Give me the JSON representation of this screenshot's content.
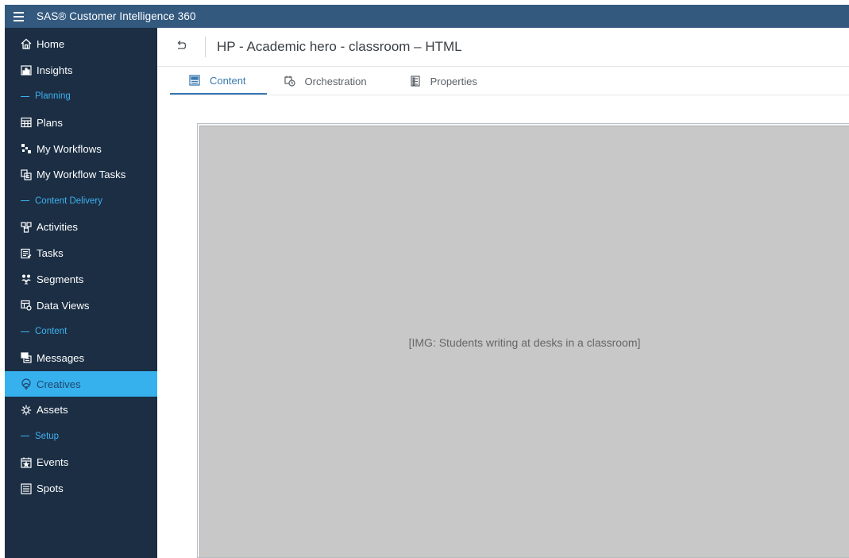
{
  "topbar": {
    "app_title": "SAS® Customer Intelligence 360",
    "menu_icon": "hamburger-icon"
  },
  "sidebar": {
    "items": [
      {
        "type": "item",
        "label": "Home",
        "icon": "home-icon"
      },
      {
        "type": "item",
        "label": "Insights",
        "icon": "insights-icon"
      },
      {
        "type": "section",
        "label": "Planning"
      },
      {
        "type": "item",
        "label": "Plans",
        "icon": "plans-icon"
      },
      {
        "type": "item",
        "label": "My Workflows",
        "icon": "workflows-icon"
      },
      {
        "type": "item",
        "label": "My Workflow Tasks",
        "icon": "workflow-tasks-icon"
      },
      {
        "type": "section",
        "label": "Content Delivery"
      },
      {
        "type": "item",
        "label": "Activities",
        "icon": "activities-icon"
      },
      {
        "type": "item",
        "label": "Tasks",
        "icon": "tasks-icon"
      },
      {
        "type": "item",
        "label": "Segments",
        "icon": "segments-icon"
      },
      {
        "type": "item",
        "label": "Data Views",
        "icon": "data-views-icon"
      },
      {
        "type": "section",
        "label": "Content"
      },
      {
        "type": "item",
        "label": "Messages",
        "icon": "messages-icon"
      },
      {
        "type": "item",
        "label": "Creatives",
        "icon": "creatives-icon",
        "active": true
      },
      {
        "type": "item",
        "label": "Assets",
        "icon": "assets-icon"
      },
      {
        "type": "section",
        "label": "Setup"
      },
      {
        "type": "item",
        "label": "Events",
        "icon": "events-icon"
      },
      {
        "type": "item",
        "label": "Spots",
        "icon": "spots-icon"
      }
    ]
  },
  "header": {
    "title": "HP - Academic hero - classroom – HTML",
    "back_icon": "back-icon"
  },
  "tabs": [
    {
      "label": "Content",
      "icon": "content-icon",
      "active": true
    },
    {
      "label": "Orchestration",
      "icon": "orchestration-icon",
      "active": false
    },
    {
      "label": "Properties",
      "icon": "properties-icon",
      "active": false
    }
  ],
  "preview": {
    "image_placeholder": "[IMG: Students writing at desks in a classroom]"
  },
  "colors": {
    "topbar": "#33597f",
    "sidebar": "#1b2e44",
    "active_item": "#36b1ee",
    "section_label": "#3eb2ef",
    "tab_active": "#3a78b0"
  }
}
